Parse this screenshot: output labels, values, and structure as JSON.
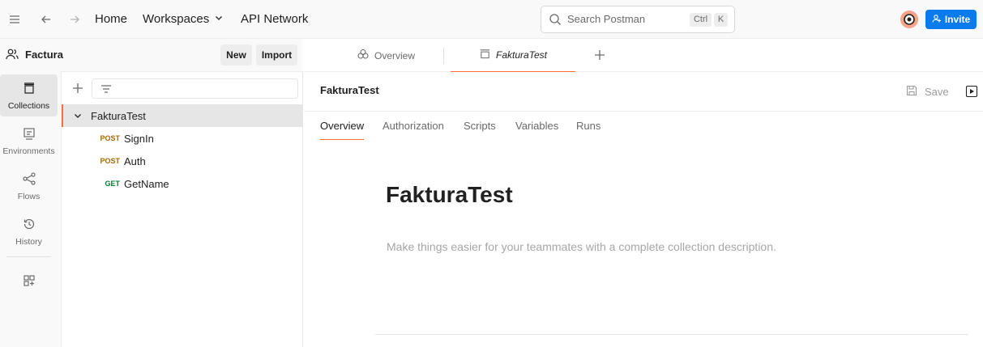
{
  "topbar": {
    "home": "Home",
    "workspaces": "Workspaces",
    "api_network": "API Network",
    "search_placeholder": "Search Postman",
    "shortcut_ctrl": "Ctrl",
    "shortcut_k": "K",
    "invite": "Invite"
  },
  "workspace": {
    "name": "Factura",
    "new": "New",
    "import": "Import"
  },
  "rail": {
    "items": [
      {
        "label": "Collections",
        "icon": "collections-icon"
      },
      {
        "label": "Environments",
        "icon": "environments-icon"
      },
      {
        "label": "Flows",
        "icon": "flows-icon"
      },
      {
        "label": "History",
        "icon": "history-icon"
      }
    ]
  },
  "tree": {
    "collection": "FakturaTest",
    "requests": [
      {
        "method": "POST",
        "name": "SignIn"
      },
      {
        "method": "POST",
        "name": "Auth"
      },
      {
        "method": "GET",
        "name": "GetName"
      }
    ]
  },
  "tabs": {
    "overview": "Overview",
    "collection": "FakturaTest"
  },
  "content": {
    "breadcrumb": "FakturaTest",
    "save": "Save",
    "subtabs": [
      "Overview",
      "Authorization",
      "Scripts",
      "Variables",
      "Runs"
    ],
    "title": "FakturaTest",
    "description_placeholder": "Make things easier for your teammates with a complete collection description."
  },
  "colors": {
    "accent": "#ff6c37",
    "primary_button": "#097bed",
    "post_method": "#a76a00",
    "get_method": "#007f31"
  }
}
